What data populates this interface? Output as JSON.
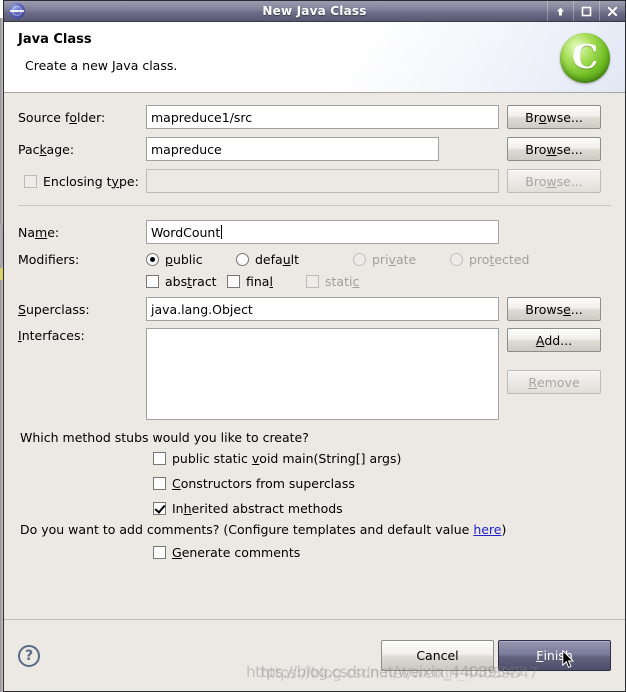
{
  "window": {
    "title": "New Java Class",
    "icon": "globe-icon",
    "buttons": {
      "minimize": "minimize-icon",
      "maximize": "maximize-icon",
      "close": "close-icon"
    }
  },
  "header": {
    "title": "Java Class",
    "description": "Create a new Java class.",
    "icon_letter": "C",
    "icon_name": "java-class-wizard-icon"
  },
  "form": {
    "source_folder": {
      "label_pre": "Source f",
      "label_mnemonic": "o",
      "label_post": "lder:",
      "value": "mapreduce1/src",
      "browse": {
        "pre": "Br",
        "mnemonic": "o",
        "post": "wse..."
      }
    },
    "package": {
      "label_pre": "Pac",
      "label_mnemonic": "k",
      "label_post": "age:",
      "value": "mapreduce",
      "browse": {
        "pre": "Bro",
        "mnemonic": "w",
        "post": "se..."
      }
    },
    "enclosing_type": {
      "label_pre": "Enclosing t",
      "label_mnemonic": "y",
      "label_post": "pe:",
      "value": "",
      "checked": false,
      "enabled": false,
      "browse": {
        "pre": "Bro",
        "mnemonic": "w",
        "post": "se..."
      }
    },
    "name": {
      "label_pre": "Na",
      "label_mnemonic": "m",
      "label_post": "e:",
      "value": "WordCount"
    },
    "modifiers": {
      "label": "Modifiers:",
      "access": [
        {
          "pre": "",
          "mnemonic": "p",
          "post": "ublic",
          "checked": true,
          "enabled": true
        },
        {
          "pre": "defa",
          "mnemonic": "u",
          "post": "lt",
          "checked": false,
          "enabled": true
        },
        {
          "pre": "pri",
          "mnemonic": "v",
          "post": "ate",
          "checked": false,
          "enabled": false
        },
        {
          "pre": "pro",
          "mnemonic": "t",
          "post": "ected",
          "checked": false,
          "enabled": false
        }
      ],
      "flags": [
        {
          "pre": "abs",
          "mnemonic": "t",
          "post": "ract",
          "checked": false,
          "enabled": true
        },
        {
          "pre": "fina",
          "mnemonic": "l",
          "post": "",
          "checked": false,
          "enabled": true
        },
        {
          "pre": "stati",
          "mnemonic": "c",
          "post": "",
          "checked": false,
          "enabled": false
        }
      ]
    },
    "superclass": {
      "label_pre": "",
      "label_mnemonic": "S",
      "label_post": "uperclass:",
      "value": "java.lang.Object",
      "browse": {
        "pre": "Brows",
        "mnemonic": "e",
        "post": "..."
      }
    },
    "interfaces": {
      "label_pre": "",
      "label_mnemonic": "I",
      "label_post": "nterfaces:",
      "items": [],
      "add": {
        "pre": "",
        "mnemonic": "A",
        "post": "dd..."
      },
      "remove": {
        "pre": "",
        "mnemonic": "R",
        "post": "emove"
      }
    }
  },
  "stubs": {
    "question": "Which method stubs would you like to create?",
    "options": [
      {
        "pre": "public static ",
        "mnemonic": "v",
        "post": "oid main(String[] args)",
        "checked": false
      },
      {
        "pre": "",
        "mnemonic": "C",
        "post": "onstructors from superclass",
        "checked": false
      },
      {
        "pre": "In",
        "mnemonic": "h",
        "post": "erited abstract methods",
        "checked": true
      }
    ]
  },
  "comments": {
    "question_pre": "Do you want to add comments? (Configure templates and default value ",
    "link": "here",
    "question_post": ")",
    "option": {
      "pre": "",
      "mnemonic": "G",
      "post": "enerate comments",
      "checked": false
    }
  },
  "footer": {
    "help": "?",
    "cancel": "Cancel",
    "finish": {
      "pre": "",
      "mnemonic": "F",
      "post": "inish"
    }
  },
  "watermark": {
    "line1": "https://blog.csdn.net/weixin_44039347",
    "line2": "https://blog.csdn.net/weixin_44039347"
  }
}
